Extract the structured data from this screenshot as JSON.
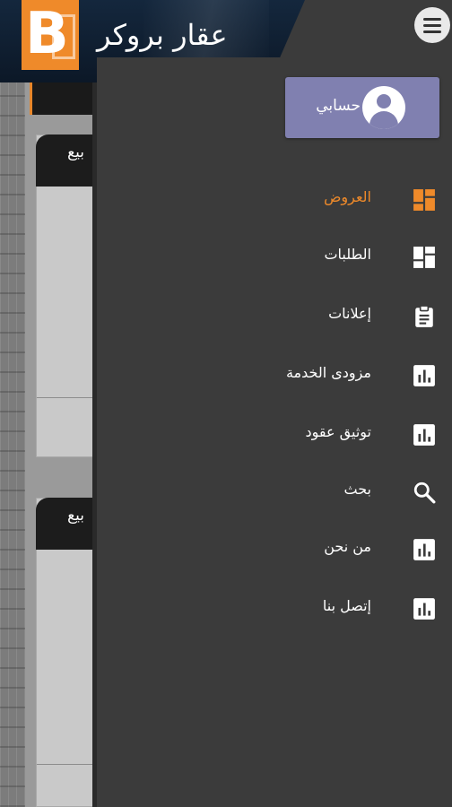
{
  "header": {
    "logo_letter": "B",
    "title": "عقار بروكر"
  },
  "background": {
    "tabs": [
      "بيع",
      "بيع"
    ]
  },
  "account": {
    "label": "حسابي"
  },
  "nav": {
    "items": [
      {
        "label": "العروض",
        "icon": "dashboard-icon",
        "active": true
      },
      {
        "label": "الطلبات",
        "icon": "dashboard-icon",
        "active": false
      },
      {
        "label": "إعلانات",
        "icon": "clipboard-icon",
        "active": false
      },
      {
        "label": "مزودى الخدمة",
        "icon": "bar-chart-icon",
        "active": false
      },
      {
        "label": "توثيق عقود",
        "icon": "bar-chart-icon",
        "active": false
      },
      {
        "label": "بحث",
        "icon": "search-icon",
        "active": false
      },
      {
        "label": "من نحن",
        "icon": "bar-chart-icon",
        "active": false
      },
      {
        "label": "إتصل بنا",
        "icon": "bar-chart-icon",
        "active": false
      }
    ]
  },
  "colors": {
    "accent": "#ef8a2a",
    "drawer_bg": "#3b3b3b",
    "account_button": "#8080b0",
    "header_navy": "#14273d"
  }
}
